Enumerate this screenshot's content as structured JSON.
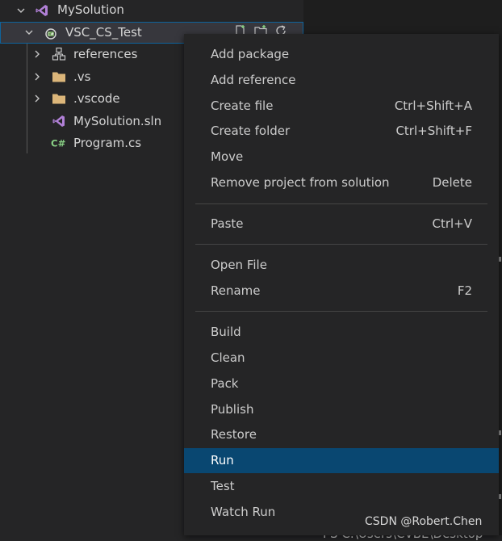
{
  "explorer": {
    "solution": {
      "name": "MySolution",
      "icon": "visual-studio-icon"
    },
    "project": {
      "name": "VSC_CS_Test",
      "icon": "csharp-project-icon",
      "actions": [
        "new-file-icon",
        "new-folder-icon",
        "refresh-icon"
      ]
    },
    "items": [
      {
        "label": "references",
        "icon": "references-icon",
        "expandable": true
      },
      {
        "label": ".vs",
        "icon": "folder-icon",
        "expandable": true
      },
      {
        "label": ".vscode",
        "icon": "folder-icon",
        "expandable": true
      },
      {
        "label": "MySolution.sln",
        "icon": "visual-studio-icon",
        "expandable": false
      },
      {
        "label": "Program.cs",
        "icon": "csharp-file-icon",
        "expandable": false
      }
    ]
  },
  "context_menu": {
    "groups": [
      [
        {
          "label": "Add package",
          "shortcut": ""
        },
        {
          "label": "Add reference",
          "shortcut": ""
        },
        {
          "label": "Create file",
          "shortcut": "Ctrl+Shift+A"
        },
        {
          "label": "Create folder",
          "shortcut": "Ctrl+Shift+F"
        },
        {
          "label": "Move",
          "shortcut": ""
        },
        {
          "label": "Remove project from solution",
          "shortcut": "Delete"
        }
      ],
      [
        {
          "label": "Paste",
          "shortcut": "Ctrl+V"
        }
      ],
      [
        {
          "label": "Open File",
          "shortcut": ""
        },
        {
          "label": "Rename",
          "shortcut": "F2"
        }
      ],
      [
        {
          "label": "Build",
          "shortcut": ""
        },
        {
          "label": "Clean",
          "shortcut": ""
        },
        {
          "label": "Pack",
          "shortcut": ""
        },
        {
          "label": "Publish",
          "shortcut": ""
        },
        {
          "label": "Restore",
          "shortcut": ""
        },
        {
          "label": "Run",
          "shortcut": "",
          "highlighted": true
        },
        {
          "label": "Test",
          "shortcut": ""
        },
        {
          "label": "Watch Run",
          "shortcut": ""
        }
      ]
    ]
  },
  "terminal": {
    "prompt_fragment": "PS C:\\Users\\CVBE\\Desktop"
  },
  "watermark": "CSDN @Robert.Chen",
  "colors": {
    "accent": "#0e639c",
    "menu_highlight": "#094771",
    "vs_purple": "#b180d7",
    "csharp_green": "#89d185",
    "folder": "#dcb67a"
  }
}
